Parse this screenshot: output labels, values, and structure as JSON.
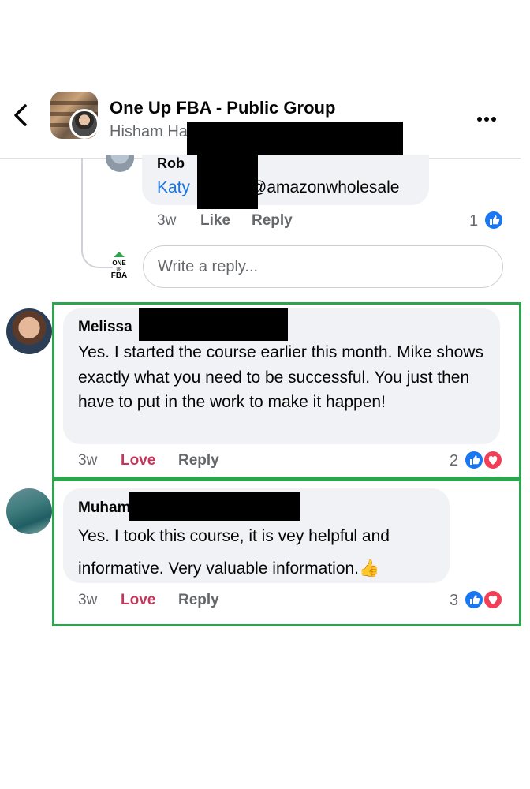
{
  "header": {
    "title": "One Up FBA - Public Group",
    "subtitle": "Hisham Ha"
  },
  "nested_reply": {
    "author": "Rob",
    "mention": "Katy",
    "text_suffix": "@amazonwholesale",
    "time": "3w",
    "like_label": "Like",
    "reply_label": "Reply",
    "reaction_count": "1"
  },
  "reply_box": {
    "placeholder": "Write a reply..."
  },
  "group_logo": {
    "line1": "ONE",
    "line2": "UP",
    "line3": "FBA"
  },
  "comments": [
    {
      "author": "Melissa",
      "text": "Yes. I started the course earlier this month. Mike shows exactly what you need to be successful. You just then have to put in the work to make it happen!",
      "time": "3w",
      "reaction_label": "Love",
      "reply_label": "Reply",
      "reaction_count": "2"
    },
    {
      "author": "Muham",
      "text": "Yes. I took this course, it is vey helpful and informative. Very valuable information.",
      "emoji": "👍",
      "time": "3w",
      "reaction_label": "Love",
      "reply_label": "Reply",
      "reaction_count": "3"
    }
  ],
  "icons": {
    "back": "chevron-left-icon",
    "more": "more-options-icon",
    "like": "like-reaction-icon",
    "love": "love-reaction-icon"
  },
  "colors": {
    "link": "#1b74e4",
    "love": "#c3385a",
    "like_blue": "#1877f2",
    "love_red": "#f33e58",
    "highlight": "#2ea44f",
    "bubble": "#f0f2f5"
  }
}
